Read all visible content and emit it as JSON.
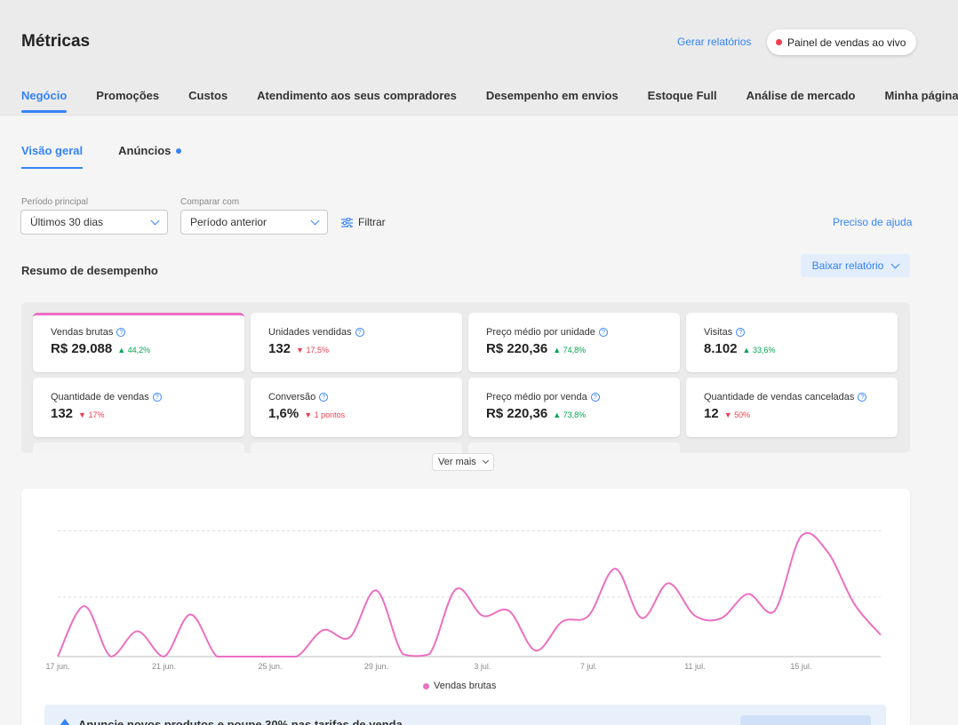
{
  "header": {
    "title": "Métricas",
    "generate_reports": "Gerar relatórios",
    "live_panel": "Painel de vendas ao vivo"
  },
  "main_tabs": [
    {
      "label": "Negócio"
    },
    {
      "label": "Promoções"
    },
    {
      "label": "Custos"
    },
    {
      "label": "Atendimento aos seus compradores"
    },
    {
      "label": "Desempenho em envios"
    },
    {
      "label": "Estoque Full"
    },
    {
      "label": "Análise de mercado"
    },
    {
      "label": "Minha página"
    }
  ],
  "sub_tabs": [
    {
      "label": "Visão geral"
    },
    {
      "label": "Anúncios"
    }
  ],
  "filters": {
    "period_label": "Período principal",
    "period_value": "Últimos 30 dias",
    "compare_label": "Comparar com",
    "compare_value": "Período anterior",
    "filter_label": "Filtrar",
    "help_link": "Preciso de ajuda"
  },
  "summary": {
    "title": "Resumo de desempenho",
    "download": "Baixar relatório",
    "see_more": "Ver mais"
  },
  "cards": [
    {
      "label": "Vendas brutas",
      "value": "R$ 29.088",
      "delta": "44,2%",
      "dir": "up"
    },
    {
      "label": "Unidades vendidas",
      "value": "132",
      "delta": "17,5%",
      "dir": "down"
    },
    {
      "label": "Preço médio por unidade",
      "value": "R$ 220,36",
      "delta": "74,8%",
      "dir": "up"
    },
    {
      "label": "Visitas",
      "value": "8.102",
      "delta": "33,6%",
      "dir": "up"
    },
    {
      "label": "Quantidade de vendas",
      "value": "132",
      "delta": "17%",
      "dir": "down"
    },
    {
      "label": "Conversão",
      "value": "1,6%",
      "delta": "1 pontos",
      "dir": "down"
    },
    {
      "label": "Preço médio por venda",
      "value": "R$ 220,36",
      "delta": "73,8%",
      "dir": "up"
    },
    {
      "label": "Quantidade de vendas canceladas",
      "value": "12",
      "delta": "50%",
      "dir": "down"
    }
  ],
  "colors": {
    "accent": "#3483fa",
    "series": "#ec6fc1",
    "up": "#00a650",
    "down": "#f23d4f"
  },
  "banner": {
    "text": "Anuncie novos produtos e poupe 30% nas tarifas de venda"
  },
  "chart_data": {
    "type": "line",
    "x_tick_labels": [
      "17 jun.",
      "21 jun.",
      "25 jun.",
      "29 jun.",
      "3 jul.",
      "7 jul.",
      "11 jul.",
      "15 jul."
    ],
    "series": [
      {
        "name": "Vendas brutas",
        "values": [
          0,
          0.42,
          0,
          0.21,
          0,
          0.35,
          0,
          0,
          0,
          0,
          0.22,
          0.16,
          0.55,
          0.02,
          0.02,
          0.56,
          0.34,
          0.38,
          0.05,
          0.29,
          0.34,
          0.73,
          0.32,
          0.61,
          0.34,
          0.32,
          0.52,
          0.38,
          1.0,
          0.87,
          0.44,
          0.18
        ]
      }
    ],
    "ylim": [
      0,
      1.1
    ],
    "grid": true,
    "legend": "bottom"
  }
}
